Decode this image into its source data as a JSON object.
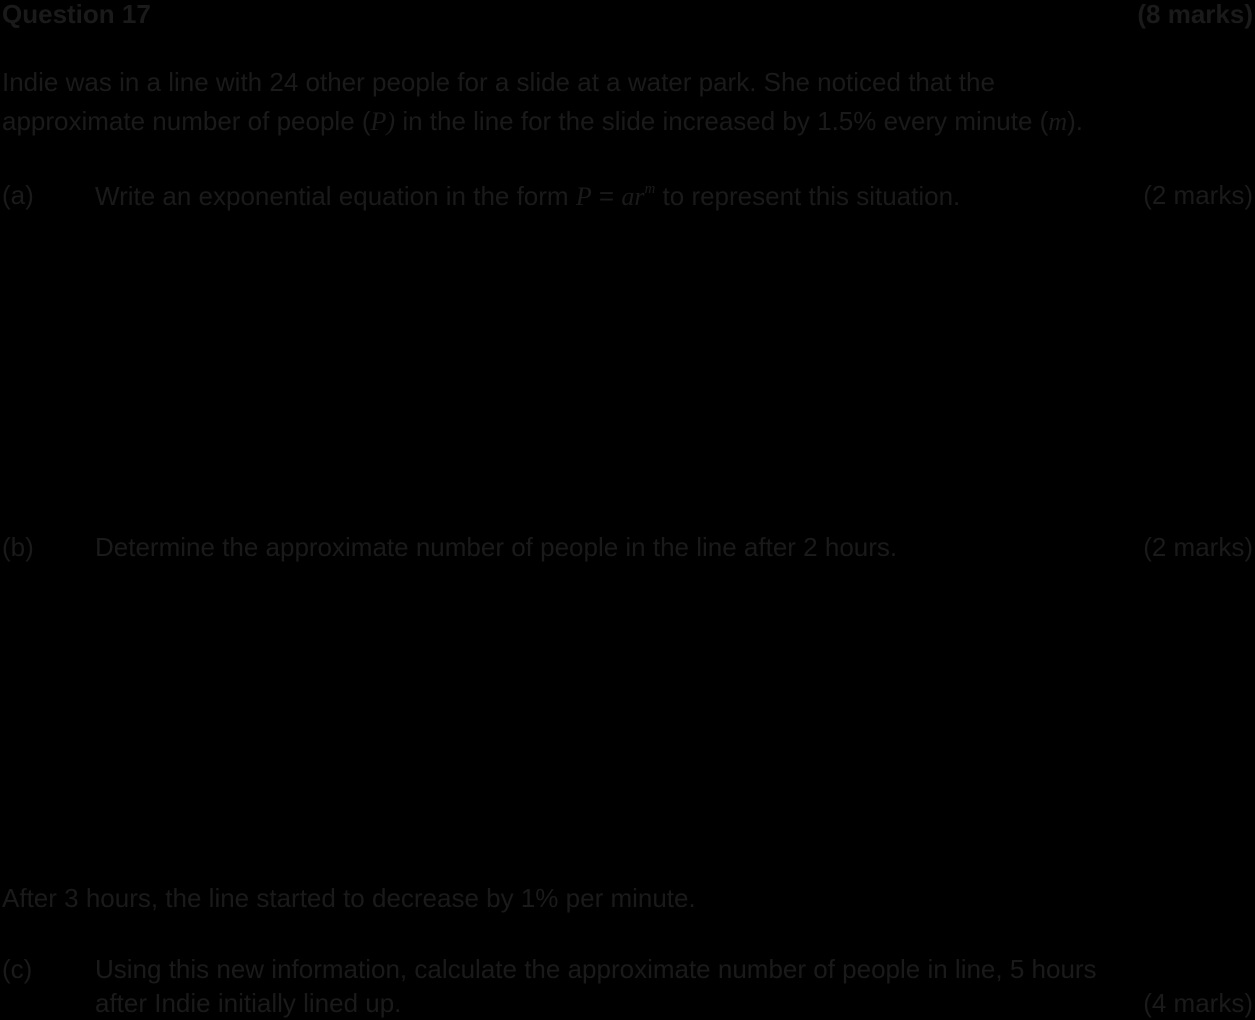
{
  "question": {
    "title": "Question 17",
    "total_marks": "(8 marks)"
  },
  "intro": {
    "line1": "Indie was in a line with 24 other people for a slide at a water park. She noticed that the",
    "line2_part1": "approximate number of people (",
    "var_p": "P)",
    "line2_part2": " in the line for the slide increased by 1.5% every minute (",
    "var_m": "m",
    "line2_part3": ")."
  },
  "part_a": {
    "label": "(a)",
    "text_before": "Write an exponential equation in the form ",
    "formula_p": "P",
    "formula_eq": " = ",
    "formula_ar": "ar",
    "formula_exp": "m",
    "text_after": " to represent this situation.",
    "marks": "(2 marks)"
  },
  "part_b": {
    "label": "(b)",
    "text": "Determine the approximate number of people in the line after 2 hours.",
    "marks": "(2 marks)"
  },
  "transition": {
    "text": "After 3 hours, the line started to decrease by 1% per minute."
  },
  "part_c": {
    "label": "(c)",
    "line1": "Using this new information, calculate the approximate number of people in line, 5 hours",
    "line2": "after Indie initially lined up.",
    "marks": "(4 marks)"
  }
}
